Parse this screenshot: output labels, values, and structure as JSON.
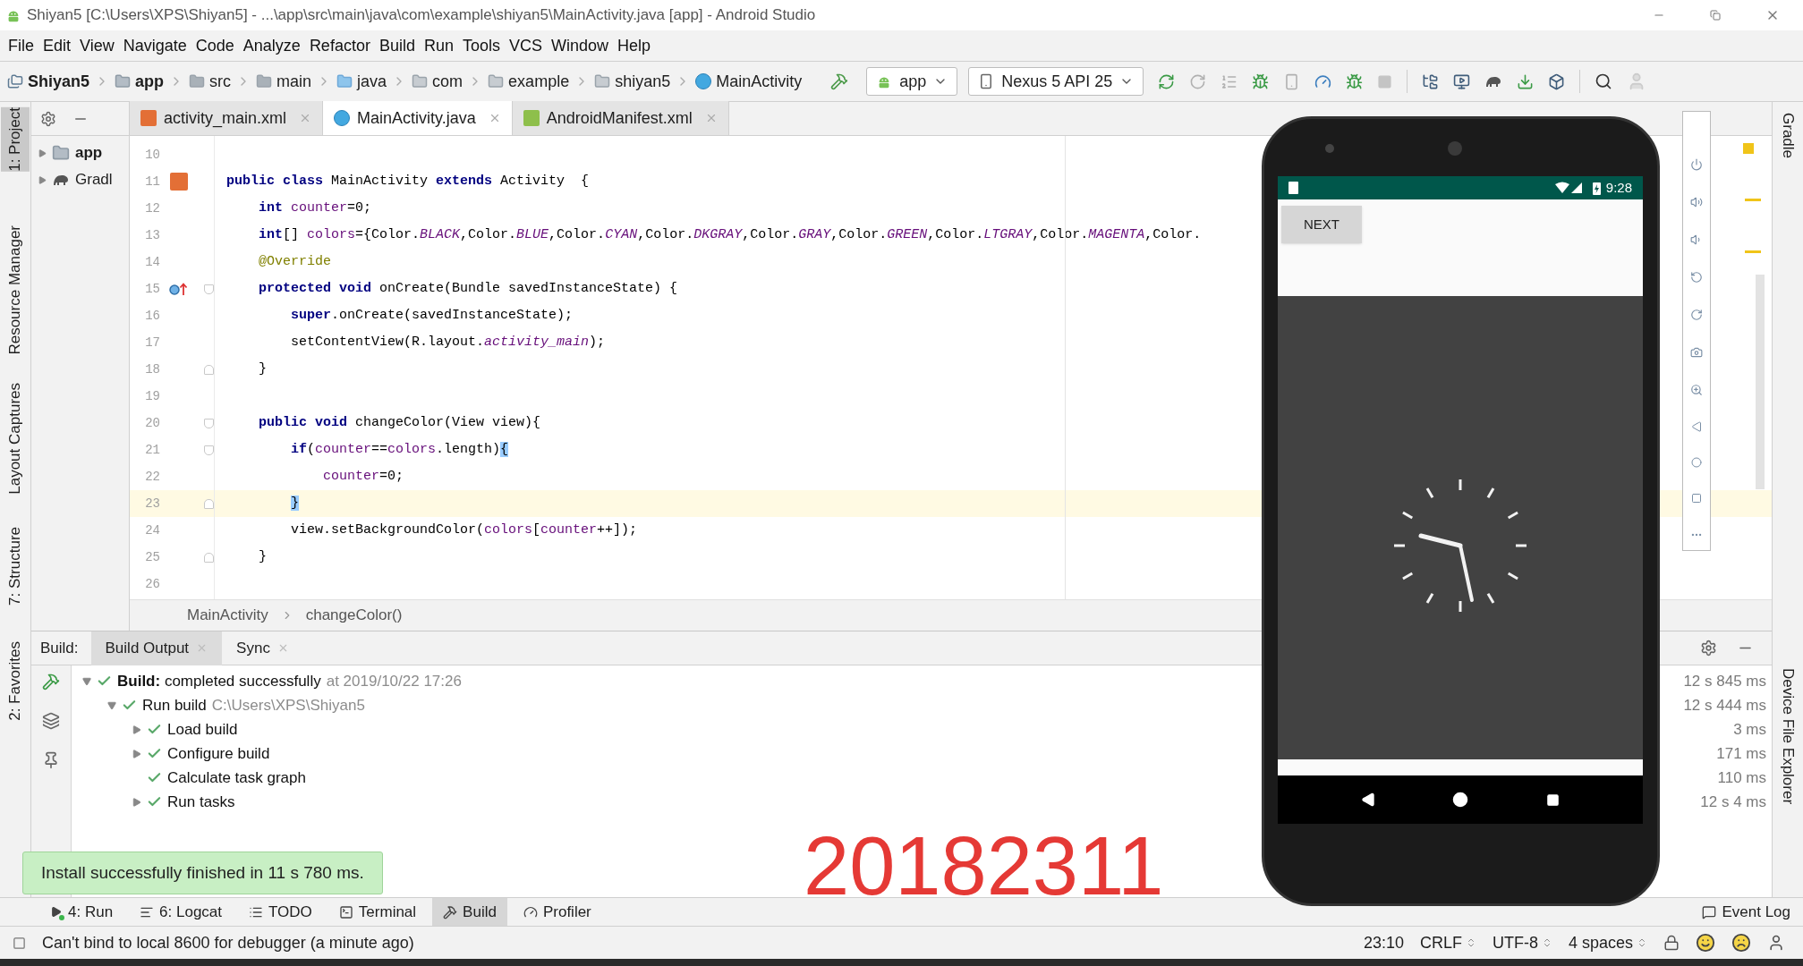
{
  "window": {
    "title": "Shiyan5 [C:\\Users\\XPS\\Shiyan5] - ...\\app\\src\\main\\java\\com\\example\\shiyan5\\MainActivity.java [app] - Android Studio"
  },
  "menu": [
    "File",
    "Edit",
    "View",
    "Navigate",
    "Code",
    "Analyze",
    "Refactor",
    "Build",
    "Run",
    "Tools",
    "VCS",
    "Window",
    "Help"
  ],
  "navigation": {
    "breadcrumbs": [
      {
        "label": "Shiyan5",
        "kind": "project"
      },
      {
        "label": "app",
        "kind": "module"
      },
      {
        "label": "src",
        "kind": "folder"
      },
      {
        "label": "main",
        "kind": "folder"
      },
      {
        "label": "java",
        "kind": "source"
      },
      {
        "label": "com",
        "kind": "package"
      },
      {
        "label": "example",
        "kind": "package"
      },
      {
        "label": "shiyan5",
        "kind": "package"
      },
      {
        "label": "MainActivity",
        "kind": "class"
      }
    ],
    "run_config": "app",
    "device": "Nexus 5 API 25"
  },
  "left_tool_strip": [
    {
      "label": "1: Project",
      "selected": true
    },
    {
      "label": "Resource Manager",
      "selected": false
    },
    {
      "label": "Layout Captures",
      "selected": false
    },
    {
      "label": "7: Structure",
      "selected": false
    },
    {
      "label": "2: Favorites",
      "selected": false
    }
  ],
  "right_tool_strip": [
    "Gradle",
    "Device File Explorer"
  ],
  "project_tree": [
    {
      "label": "app",
      "kind": "module"
    },
    {
      "label": "Gradl",
      "kind": "gradle"
    }
  ],
  "editor_tabs": [
    {
      "label": "activity_main.xml",
      "kind": "layout",
      "selected": false
    },
    {
      "label": "MainActivity.java",
      "kind": "class",
      "selected": true
    },
    {
      "label": "AndroidManifest.xml",
      "kind": "manifest",
      "selected": false
    }
  ],
  "code_lines": [
    {
      "number": "10",
      "current": false
    },
    {
      "number": "11",
      "current": false,
      "gutter": {
        "kind": "layout"
      },
      "tokens": [
        {
          "text": "public class ",
          "kind": "keyword"
        },
        {
          "text": "MainActivity ",
          "kind": "plain"
        },
        {
          "text": "extends ",
          "kind": "keyword"
        },
        {
          "text": "Activity  {",
          "kind": "plain"
        }
      ]
    },
    {
      "number": "12",
      "current": false,
      "tokens": [
        {
          "text": "    int ",
          "kind": "keyword"
        },
        {
          "text": "counter",
          "kind": "field"
        },
        {
          "text": "=0;",
          "kind": "plain"
        }
      ]
    },
    {
      "number": "13",
      "current": false,
      "tokens": [
        {
          "text": "    int",
          "kind": "keyword"
        },
        {
          "text": "[] ",
          "kind": "plain"
        },
        {
          "text": "colors",
          "kind": "field"
        },
        {
          "text": "={Color.",
          "kind": "plain"
        },
        {
          "text": "BLACK",
          "kind": "static"
        },
        {
          "text": ",Color.",
          "kind": "plain"
        },
        {
          "text": "BLUE",
          "kind": "static"
        },
        {
          "text": ",Color.",
          "kind": "plain"
        },
        {
          "text": "CYAN",
          "kind": "static"
        },
        {
          "text": ",Color.",
          "kind": "plain"
        },
        {
          "text": "DKGRAY",
          "kind": "static"
        },
        {
          "text": ",Color.",
          "kind": "plain"
        },
        {
          "text": "GRAY",
          "kind": "static"
        },
        {
          "text": ",Color.",
          "kind": "plain"
        },
        {
          "text": "GREEN",
          "kind": "static"
        },
        {
          "text": ",Color.",
          "kind": "plain"
        },
        {
          "text": "LTGRAY",
          "kind": "static"
        },
        {
          "text": ",Color.",
          "kind": "plain"
        },
        {
          "text": "MAGENTA",
          "kind": "static"
        },
        {
          "text": ",Color.",
          "kind": "plain"
        }
      ]
    },
    {
      "number": "14",
      "current": false,
      "tokens": [
        {
          "text": "    @Override",
          "kind": "annotation"
        }
      ]
    },
    {
      "number": "15",
      "current": false,
      "gutter": {
        "kind": "override"
      },
      "fold": {
        "kind": "start"
      },
      "tokens": [
        {
          "text": "    protected void ",
          "kind": "keyword"
        },
        {
          "text": "onCreate(Bundle savedInstanceState) {",
          "kind": "plain"
        }
      ]
    },
    {
      "number": "16",
      "current": false,
      "tokens": [
        {
          "text": "        super",
          "kind": "keyword"
        },
        {
          "text": ".onCreate(savedInstanceState);",
          "kind": "plain"
        }
      ]
    },
    {
      "number": "17",
      "current": false,
      "tokens": [
        {
          "text": "        setContentView(R.layout.",
          "kind": "plain"
        },
        {
          "text": "activity_main",
          "kind": "static"
        },
        {
          "text": ");",
          "kind": "plain"
        }
      ]
    },
    {
      "number": "18",
      "current": false,
      "fold": {
        "kind": "end"
      },
      "tokens": [
        {
          "text": "    }",
          "kind": "plain"
        }
      ]
    },
    {
      "number": "19",
      "current": false
    },
    {
      "number": "20",
      "current": false,
      "fold": {
        "kind": "start"
      },
      "tokens": [
        {
          "text": "    public void ",
          "kind": "keyword"
        },
        {
          "text": "changeColor(View view){",
          "kind": "plain"
        }
      ]
    },
    {
      "number": "21",
      "current": false,
      "fold": {
        "kind": "start"
      },
      "tokens": [
        {
          "text": "        if",
          "kind": "keyword"
        },
        {
          "text": "(",
          "kind": "plain"
        },
        {
          "text": "counter",
          "kind": "field"
        },
        {
          "text": "==",
          "kind": "plain"
        },
        {
          "text": "colors",
          "kind": "field"
        },
        {
          "text": ".length)",
          "kind": "plain"
        },
        {
          "text": "{",
          "kind": "brace"
        }
      ]
    },
    {
      "number": "22",
      "current": false,
      "tokens": [
        {
          "text": "            counter",
          "kind": "field"
        },
        {
          "text": "=0;",
          "kind": "plain"
        }
      ]
    },
    {
      "number": "23",
      "current": true,
      "fold": {
        "kind": "end"
      },
      "tokens": [
        {
          "text": "        }",
          "kind": "brace"
        }
      ]
    },
    {
      "number": "24",
      "current": false,
      "tokens": [
        {
          "text": "        view.setBackgroundColor(",
          "kind": "plain"
        },
        {
          "text": "colors",
          "kind": "field"
        },
        {
          "text": "[",
          "kind": "plain"
        },
        {
          "text": "counter",
          "kind": "field"
        },
        {
          "text": "++]);",
          "kind": "plain"
        }
      ]
    },
    {
      "number": "25",
      "current": false,
      "fold": {
        "kind": "end"
      },
      "tokens": [
        {
          "text": "    }",
          "kind": "plain"
        }
      ]
    },
    {
      "number": "26",
      "current": false
    }
  ],
  "breadcrumb": [
    "MainActivity",
    "changeColor()"
  ],
  "build_window": {
    "label": "Build:",
    "tabs": [
      {
        "label": "Build Output",
        "selected": true
      },
      {
        "label": "Sync",
        "selected": false
      }
    ],
    "tree": [
      {
        "label": "**Build:** completed successfully",
        "detail": "at 2019/10/22 17:26",
        "time": "12 s 845 ms",
        "kind": "group",
        "expanded": true,
        "children": [
          {
            "label": "Run build",
            "detail": "C:\\Users\\XPS\\Shiyan5",
            "time": "12 s 444 ms",
            "kind": "group",
            "expanded": true,
            "children": [
              {
                "label": "Load build",
                "time": "3 ms",
                "kind": "group",
                "expanded": false
              },
              {
                "label": "Configure build",
                "time": "171 ms",
                "kind": "group",
                "expanded": false
              },
              {
                "label": "Calculate task graph",
                "time": "110 ms",
                "kind": "leaf",
                "expanded": false
              },
              {
                "label": "Run tasks",
                "time": "12 s 4 ms",
                "kind": "group",
                "expanded": false
              }
            ]
          }
        ]
      }
    ]
  },
  "toast": "Install successfully finished in 11 s 780 ms.",
  "overlay_number": "20182311",
  "bottom_tools": [
    {
      "label": "4: Run",
      "kind": "run",
      "selected": false
    },
    {
      "label": "6: Logcat",
      "kind": "logcat",
      "selected": false
    },
    {
      "label": "TODO",
      "kind": "todo",
      "selected": false
    },
    {
      "label": "Terminal",
      "kind": "terminal",
      "selected": false
    },
    {
      "label": "Build",
      "kind": "build",
      "selected": true
    },
    {
      "label": "Profiler",
      "kind": "profiler",
      "selected": false
    }
  ],
  "event_log": "Event Log",
  "status": {
    "message": "Can't bind to local 8600 for debugger (a minute ago)",
    "items": [
      {
        "label": "23:10",
        "dropdown": false
      },
      {
        "label": "CRLF",
        "dropdown": true
      },
      {
        "label": "UTF-8",
        "dropdown": true
      },
      {
        "label": "4 spaces",
        "dropdown": true
      }
    ]
  },
  "emulator": {
    "status_time": "9:28",
    "button": "NEXT"
  }
}
